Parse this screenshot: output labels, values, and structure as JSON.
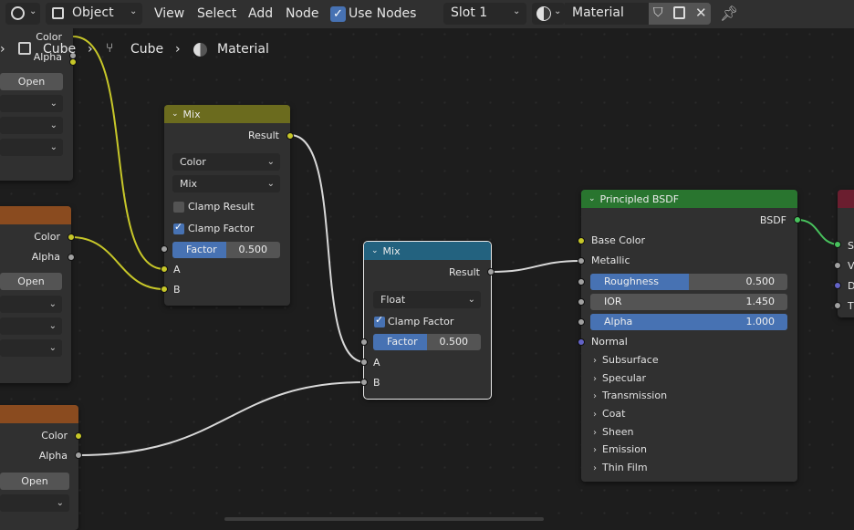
{
  "header": {
    "mode": "Object",
    "menus": [
      "View",
      "Select",
      "Add",
      "Node"
    ],
    "use_nodes": "Use Nodes",
    "slot": "Slot 1",
    "material": "Material"
  },
  "breadcrumb": [
    "Cube",
    "Cube",
    "Material"
  ],
  "left_nodes": {
    "top": {
      "color": "Color",
      "alpha": "Alpha",
      "open": "Open"
    },
    "middle": {
      "color": "Color",
      "alpha": "Alpha",
      "open": "Open"
    },
    "bottom": {
      "color": "Color",
      "alpha": "Alpha",
      "open": "Open"
    }
  },
  "mix1": {
    "title": "Mix",
    "result": "Result",
    "data_type": "Color",
    "blend": "Mix",
    "clamp_result": "Clamp Result",
    "clamp_factor": "Clamp Factor",
    "factor_label": "Factor",
    "factor_value": "0.500",
    "factor_fraction": 0.5,
    "a": "A",
    "b": "B"
  },
  "mix2": {
    "title": "Mix",
    "result": "Result",
    "data_type": "Float",
    "clamp_factor": "Clamp Factor",
    "factor_label": "Factor",
    "factor_value": "0.500",
    "factor_fraction": 0.5,
    "a": "A",
    "b": "B"
  },
  "bsdf": {
    "title": "Principled BSDF",
    "output": "BSDF",
    "base_color": "Base Color",
    "metallic": "Metallic",
    "roughness": {
      "label": "Roughness",
      "value": "0.500",
      "fraction": 0.5
    },
    "ior": {
      "label": "IOR",
      "value": "1.450",
      "fraction": 0
    },
    "alpha": {
      "label": "Alpha",
      "value": "1.000",
      "fraction": 1.0
    },
    "normal": "Normal",
    "panels": [
      "Subsurface",
      "Specular",
      "Transmission",
      "Coat",
      "Sheen",
      "Emission",
      "Thin Film"
    ]
  },
  "right_node": {
    "inputs": [
      "S",
      "V",
      "D",
      "T"
    ]
  },
  "colors": {
    "header_mix": "#6b6b1e",
    "header_mix_float": "#23627f",
    "header_bsdf": "#29752f",
    "header_image": "#8a4b1f",
    "accent": "#4772b3",
    "wire_color": "#c7c729",
    "wire_float": "#d8d8d8"
  }
}
